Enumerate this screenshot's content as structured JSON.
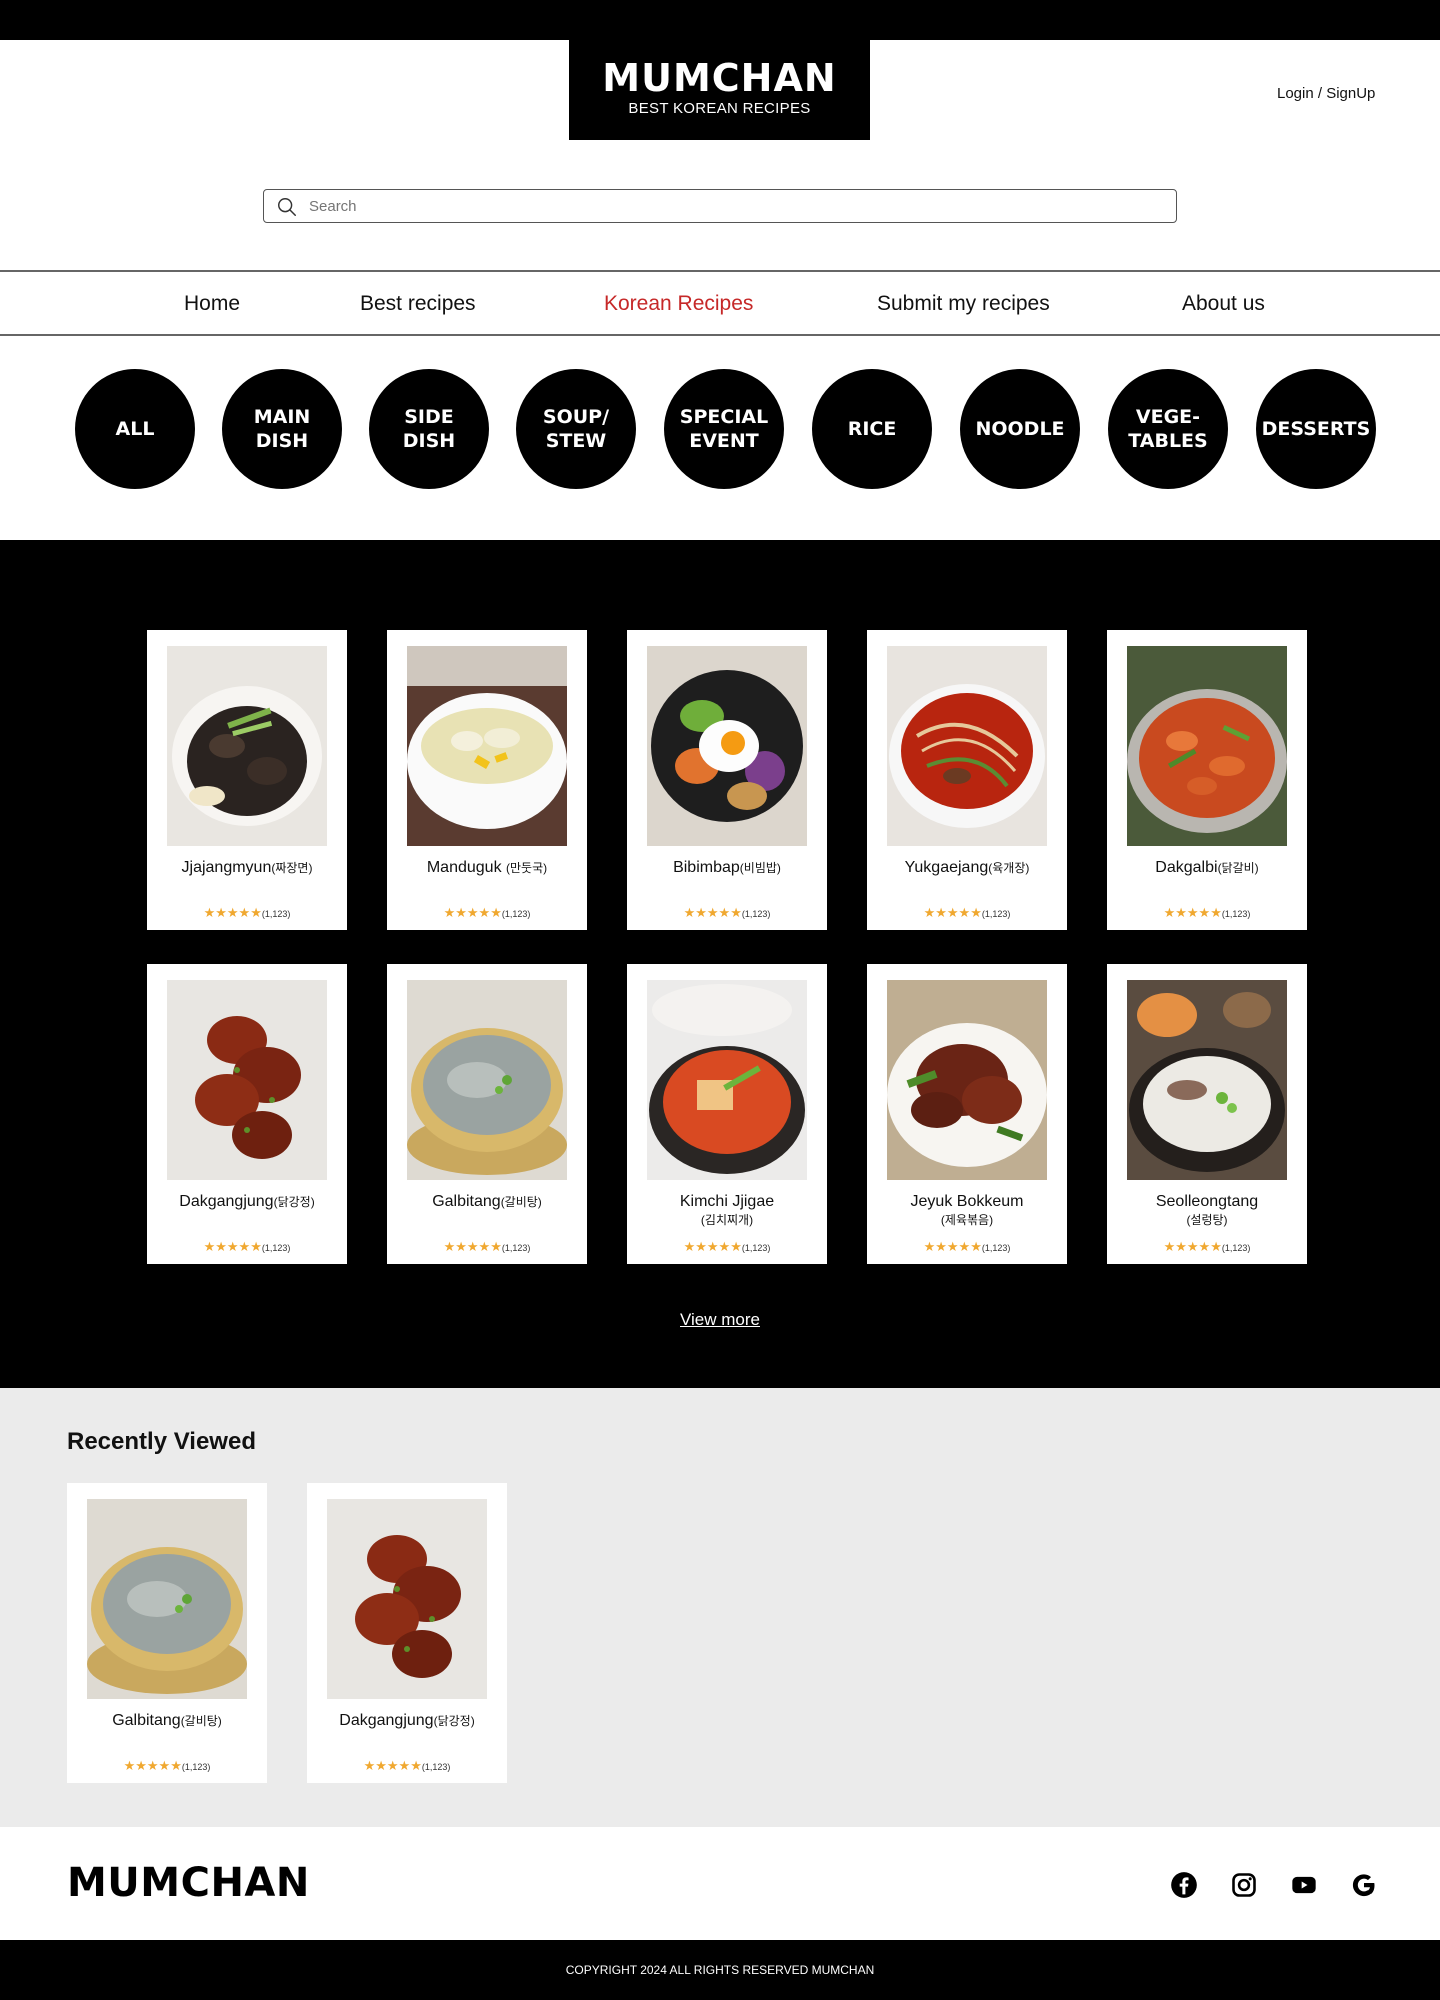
{
  "brand": {
    "name": "MUMCHAN",
    "tagline": "BEST KOREAN RECIPES"
  },
  "auth": {
    "label": "Login / SignUp"
  },
  "search": {
    "placeholder": "Search"
  },
  "nav": {
    "items": [
      {
        "label": "Home",
        "active": false
      },
      {
        "label": "Best recipes",
        "active": false
      },
      {
        "label": "Korean Recipes",
        "active": true
      },
      {
        "label": "Submit my recipes",
        "active": false
      },
      {
        "label": "About us",
        "active": false
      }
    ]
  },
  "categories": [
    "ALL",
    "MAIN\nDISH",
    "SIDE\nDISH",
    "SOUP/\nSTEW",
    "SPECIAL\nEVENT",
    "RICE",
    "NOODLE",
    "VEGE-\nTABLES",
    "DESSERTS"
  ],
  "recipes": [
    {
      "name": "Jjajangmyun",
      "korean": "(짜장면)",
      "stars": "★★★★★",
      "count": "(1,123)",
      "icon": "jjajangmyun-photo"
    },
    {
      "name": "Manduguk ",
      "korean": "(만둣국)",
      "stars": "★★★★★",
      "count": "(1,123)",
      "icon": "manduguk-photo"
    },
    {
      "name": "Bibimbap",
      "korean": "(비빔밥)",
      "stars": "★★★★★",
      "count": "(1,123)",
      "icon": "bibimbap-photo"
    },
    {
      "name": "Yukgaejang",
      "korean": "(육개장)",
      "stars": "★★★★★",
      "count": "(1,123)",
      "icon": "yukgaejang-photo"
    },
    {
      "name": "Dakgalbi",
      "korean": "(닭갈비)",
      "stars": "★★★★★",
      "count": "(1,123)",
      "icon": "dakgalbi-photo"
    },
    {
      "name": "Dakgangjung",
      "korean": "(닭강정)",
      "stars": "★★★★★",
      "count": "(1,123)",
      "icon": "dakgangjung-photo"
    },
    {
      "name": "Galbitang",
      "korean": "(갈비탕)",
      "stars": "★★★★★",
      "count": "(1,123)",
      "icon": "galbitang-photo"
    },
    {
      "name": "Kimchi Jjigae",
      "korean": "(김치찌개)",
      "stars": "★★★★★",
      "count": "(1,123)",
      "icon": "kimchi-jjigae-photo"
    },
    {
      "name": "Jeyuk Bokkeum",
      "korean": "(제육볶음)",
      "stars": "★★★★★",
      "count": "(1,123)",
      "icon": "jeyuk-bokkeum-photo"
    },
    {
      "name": "Seolleongtang",
      "korean": "(설렁탕)",
      "stars": "★★★★★",
      "count": "(1,123)",
      "icon": "seolleongtang-photo"
    }
  ],
  "view_more": "View more",
  "recent": {
    "title": "Recently Viewed",
    "items": [
      {
        "name": "Galbitang",
        "korean": "(갈비탕)",
        "stars": "★★★★★",
        "count": "(1,123)",
        "icon": "galbitang-photo"
      },
      {
        "name": "Dakgangjung",
        "korean": "(닭강정)",
        "stars": "★★★★★",
        "count": "(1,123)",
        "icon": "dakgangjung-photo"
      }
    ]
  },
  "footer": {
    "logo": "MUMCHAN",
    "social": [
      "facebook-icon",
      "instagram-icon",
      "youtube-icon",
      "google-icon"
    ],
    "copyright": "COPYRIGHT 2024 ALL RIGHTS RESERVED MUMCHAN"
  },
  "colors": {
    "accent": "#c62828",
    "star": "#f0a830",
    "dark": "#000000",
    "light_section": "#ebebeb"
  }
}
